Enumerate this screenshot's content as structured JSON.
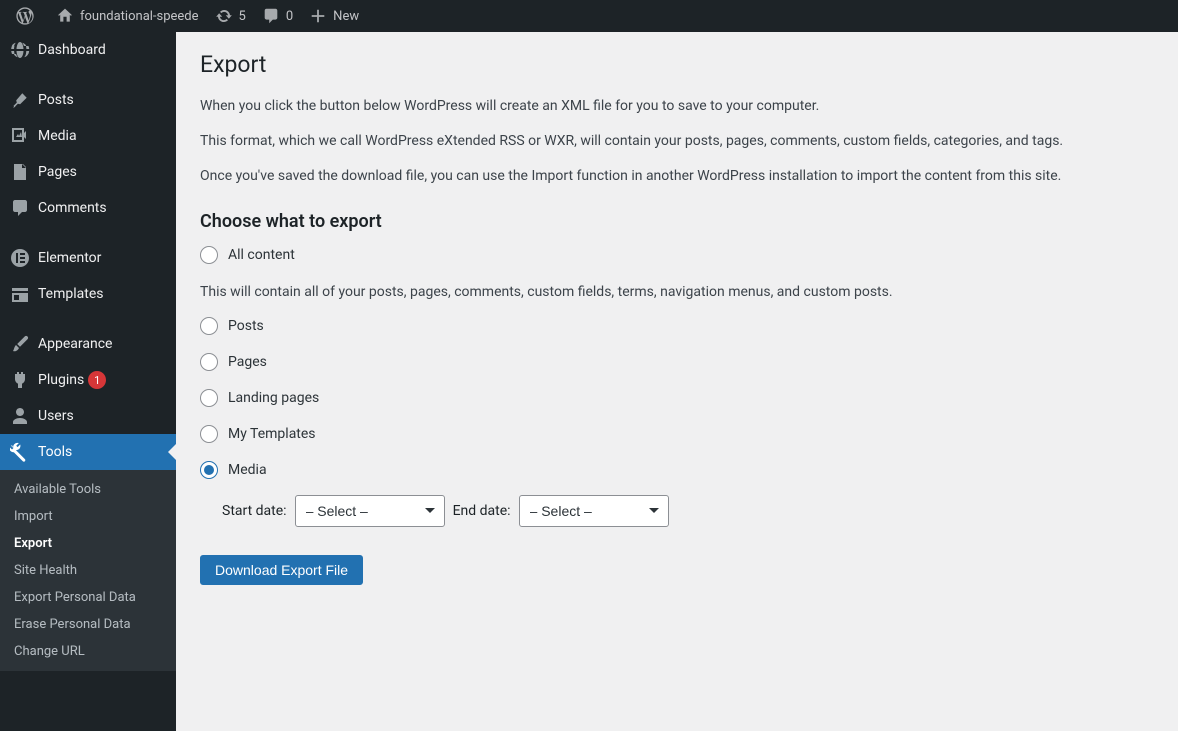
{
  "adminbar": {
    "site_name": "foundational-speede",
    "updates_count": "5",
    "comments_count": "0",
    "new_label": "New"
  },
  "sidebar": {
    "dashboard": "Dashboard",
    "posts": "Posts",
    "media": "Media",
    "pages": "Pages",
    "comments": "Comments",
    "elementor": "Elementor",
    "templates": "Templates",
    "appearance": "Appearance",
    "plugins": "Plugins",
    "plugins_badge": "1",
    "users": "Users",
    "tools": "Tools",
    "submenu": {
      "available_tools": "Available Tools",
      "import": "Import",
      "export": "Export",
      "site_health": "Site Health",
      "export_personal": "Export Personal Data",
      "erase_personal": "Erase Personal Data",
      "change_url": "Change URL"
    }
  },
  "main": {
    "title": "Export",
    "p1": "When you click the button below WordPress will create an XML file for you to save to your computer.",
    "p2": "This format, which we call WordPress eXtended RSS or WXR, will contain your posts, pages, comments, custom fields, categories, and tags.",
    "p3": "Once you've saved the download file, you can use the Import function in another WordPress installation to import the content from this site.",
    "choose_heading": "Choose what to export",
    "options": {
      "all": "All content",
      "all_desc": "This will contain all of your posts, pages, comments, custom fields, terms, navigation menus, and custom posts.",
      "posts": "Posts",
      "pages": "Pages",
      "landing": "Landing pages",
      "templates": "My Templates",
      "media": "Media"
    },
    "start_date_label": "Start date:",
    "end_date_label": "End date:",
    "select_placeholder": "– Select –",
    "download_btn": "Download Export File"
  }
}
